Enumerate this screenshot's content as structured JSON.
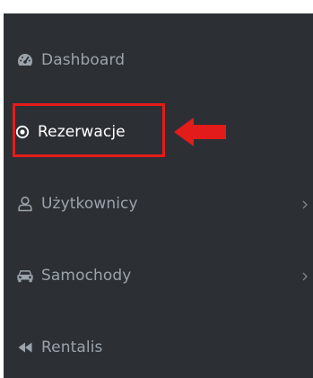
{
  "sidebar": {
    "items": [
      {
        "label": "Dashboard",
        "icon": "tachometer-icon"
      },
      {
        "label": "Rezerwacje",
        "icon": "dot-circle-icon"
      },
      {
        "label": "Użytkownicy",
        "icon": "user-icon"
      },
      {
        "label": "Samochody",
        "icon": "car-icon"
      },
      {
        "label": "Rentalis",
        "icon": "backward-icon"
      }
    ]
  },
  "colors": {
    "sidebar_bg": "#2c3035",
    "text_muted": "#9ba3ab",
    "text_active": "#ffffff",
    "annotation_red": "#e31b1b"
  }
}
